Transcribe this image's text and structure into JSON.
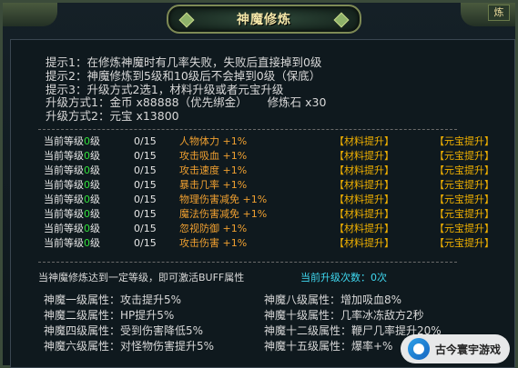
{
  "window": {
    "title": "神魔修炼",
    "right_tab": "炼"
  },
  "tips": [
    "提示1：在修炼神魔时有几率失败，失败后直接掉到0级",
    "提示2：神魔修炼到5级和10级后不会掉到0级（保底）",
    "提示3：升级方式2选1，材料升级或者元宝升级"
  ],
  "upgrade_methods": {
    "method1_label": "升级方式1：金币",
    "method1_cost": "x88888（优先绑金）",
    "method1_item": "修炼石",
    "method1_item_qty": "x30",
    "method2_label": "升级方式2：元宝",
    "method2_cost": "x13800"
  },
  "rows": [
    {
      "level_prefix": "当前等级",
      "level": "0",
      "level_suffix": "级",
      "progress": "0/15",
      "attr": "人物体力",
      "bonus": "+1%",
      "btn_material": "【材料提升】",
      "btn_yuanbao": "【元宝提升】"
    },
    {
      "level_prefix": "当前等级",
      "level": "0",
      "level_suffix": "级",
      "progress": "0/15",
      "attr": "攻击吸血",
      "bonus": "+1%",
      "btn_material": "【材料提升】",
      "btn_yuanbao": "【元宝提升】"
    },
    {
      "level_prefix": "当前等级",
      "level": "0",
      "level_suffix": "级",
      "progress": "0/15",
      "attr": "攻击速度",
      "bonus": "+1%",
      "btn_material": "【材料提升】",
      "btn_yuanbao": "【元宝提升】"
    },
    {
      "level_prefix": "当前等级",
      "level": "0",
      "level_suffix": "级",
      "progress": "0/15",
      "attr": "暴击几率",
      "bonus": "+1%",
      "btn_material": "【材料提升】",
      "btn_yuanbao": "【元宝提升】"
    },
    {
      "level_prefix": "当前等级",
      "level": "0",
      "level_suffix": "级",
      "progress": "0/15",
      "attr": "物理伤害减免",
      "bonus": "+1%",
      "btn_material": "【材料提升】",
      "btn_yuanbao": "【元宝提升】"
    },
    {
      "level_prefix": "当前等级",
      "level": "0",
      "level_suffix": "级",
      "progress": "0/15",
      "attr": "魔法伤害减免",
      "bonus": "+1%",
      "btn_material": "【材料提升】",
      "btn_yuanbao": "【元宝提升】"
    },
    {
      "level_prefix": "当前等级",
      "level": "0",
      "level_suffix": "级",
      "progress": "0/15",
      "attr": "忽视防御",
      "bonus": "+1%",
      "btn_material": "【材料提升】",
      "btn_yuanbao": "【元宝提升】"
    },
    {
      "level_prefix": "当前等级",
      "level": "0",
      "level_suffix": "级",
      "progress": "0/15",
      "attr": "攻击伤害",
      "bonus": "+1%",
      "btn_material": "【材料提升】",
      "btn_yuanbao": "【元宝提升】"
    }
  ],
  "buff": {
    "note": "当神魔修炼达到一定等级，即可激活BUFF属性",
    "count_label": "当前升级次数：",
    "count_value": "0次",
    "items": [
      [
        "神魔一级属性：攻击提升5%",
        "神魔八级属性：增加吸血8%"
      ],
      [
        "神魔二级属性：HP提升5%",
        "神魔十级属性：几率冰冻敌方2秒"
      ],
      [
        "神魔四级属性：受到伤害降低5%",
        "神魔十二级属性：鞭尸几率提升20%"
      ],
      [
        "神魔六级属性：对怪物伤害提升5%",
        "神魔十五级属性：爆率+%"
      ]
    ]
  },
  "watermark": {
    "text": "古今寰宇游戏"
  },
  "colors": {
    "title": "#f3e7a8",
    "attr": "#f0a030",
    "button": "#f0b000",
    "level": "#32e03c",
    "count": "#3fd8f0"
  }
}
